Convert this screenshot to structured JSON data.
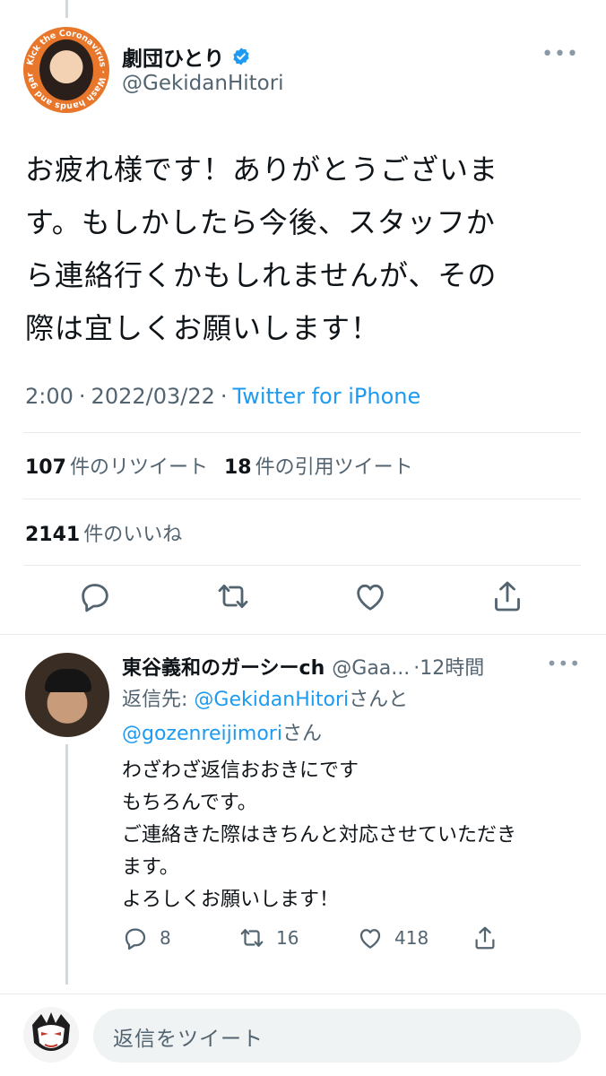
{
  "main_tweet": {
    "display_name": "劇団ひとり",
    "handle": "@GekidanHitori",
    "more": "•••",
    "avatar_ring_text": "Kick the Coronavirus Wash hands and gargle",
    "text_lines": [
      "お疲れ様です！ありがとうございま",
      "す。もしかしたら今後、スタッフか",
      "ら連絡行くかもしれませんが、その",
      "際は宜しくお願いします！"
    ],
    "time": "2:00",
    "sep1": "·",
    "date": "2022/03/22",
    "sep2": "·",
    "source": "Twitter for iPhone",
    "retweets_count": "107",
    "retweets_label": "件のリツイート",
    "quotes_count": "18",
    "quotes_label": "件の引用ツイート",
    "likes_count": "2141",
    "likes_label": "件のいいね"
  },
  "reply": {
    "display_name": "東谷義和のガーシーch",
    "handle": "@Gaa...",
    "time": "·12時間",
    "more": "•••",
    "reply_to_prefix": "返信先: ",
    "mention1": "@GekidanHitori",
    "mention1_suffix": "さんと",
    "mention2": "@gozenreijimori",
    "mention2_suffix": "さん",
    "text_lines": [
      "わざわざ返信おおきにです",
      "もちろんです。",
      "ご連絡きた際はきちんと対応させていただき",
      "ます。",
      "よろしくお願いします！"
    ],
    "replies": "8",
    "retweets": "16",
    "likes": "418"
  },
  "composer": {
    "placeholder": "返信をツイート"
  },
  "colors": {
    "accent": "#1d9bf0",
    "text": "#0f1419",
    "muted": "#536471",
    "divider": "#e6ecf0"
  }
}
